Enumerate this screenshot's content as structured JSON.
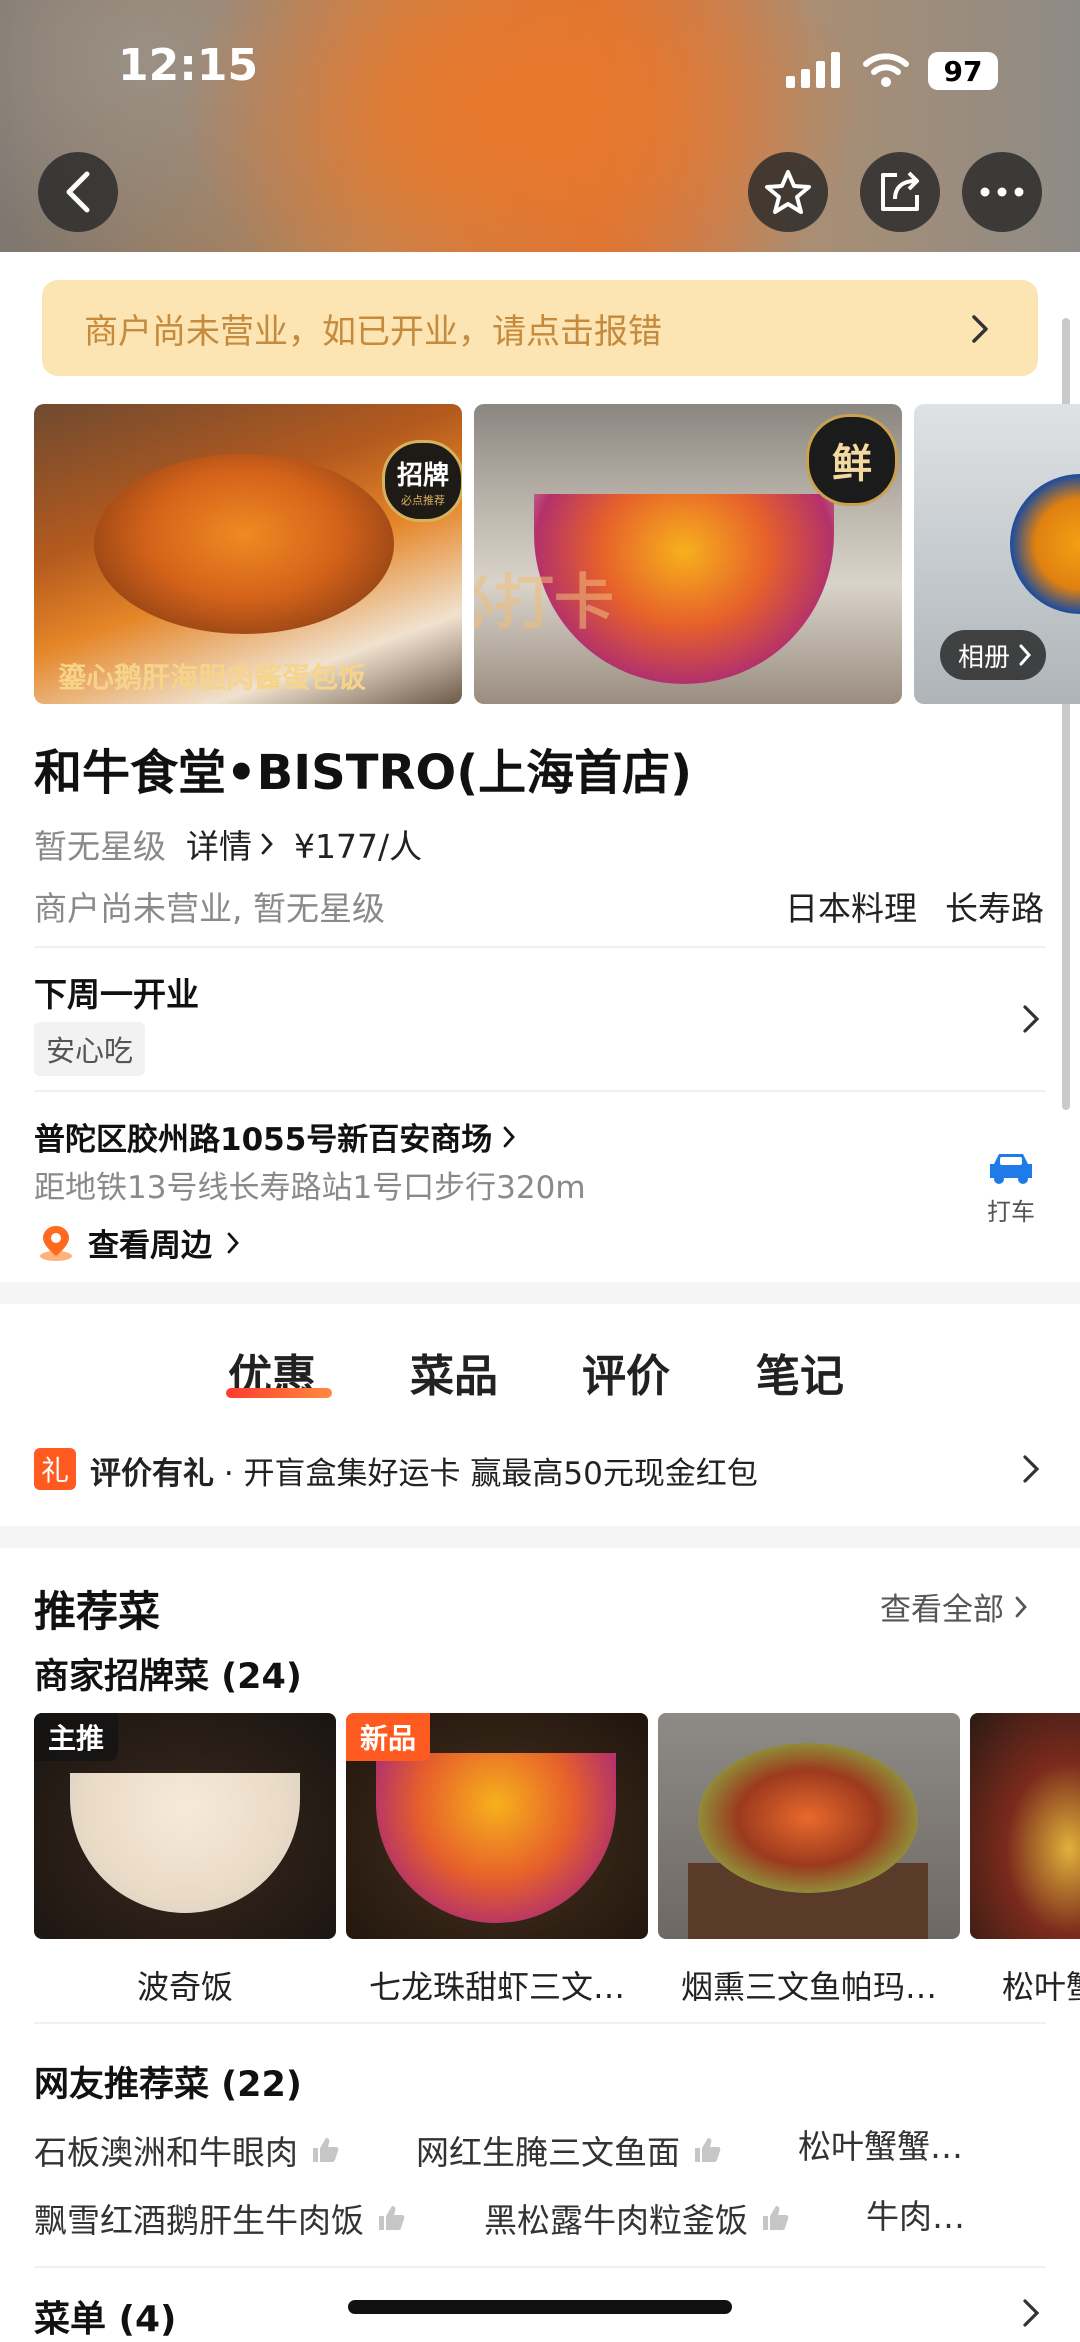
{
  "status": {
    "time": "12:15",
    "battery": "97"
  },
  "banner": {
    "text": "商户尚未营业，如已开业，请点击报错"
  },
  "gallery": {
    "photo1_caption": "鎏心鹅肝海胆肉酱蛋包饭",
    "photo1_badge": "招牌",
    "photo1_badge_sub": "必点推荐",
    "photo2_badge": "鲜",
    "photo2_overlay": "必打卡",
    "album_label": "相册"
  },
  "shop": {
    "name": "和牛食堂•BISTRO(上海首店)",
    "rating": "暂无星级",
    "detail_link": "详情",
    "price": "¥177/人",
    "status_note": "商户尚未营业, 暂无星级",
    "cuisine": "日本料理",
    "area": "长寿路"
  },
  "hours": {
    "text": "下周一开业",
    "tag": "安心吃"
  },
  "address": {
    "line": "普陀区胶州路1055号新百安商场",
    "distance": "距地铁13号线长寿路站1号口步行320m",
    "nearby": "查看周边",
    "taxi": "打车"
  },
  "tabs": [
    "优惠",
    "菜品",
    "评价",
    "笔记"
  ],
  "promo": {
    "icon": "礼",
    "bold": "评价有礼",
    "text": " · 开盲盒集好运卡 赢最高50元现金红包"
  },
  "recommend": {
    "title": "推荐菜",
    "view_all": "查看全部",
    "signature_title": "商家招牌菜 (24)",
    "dishes": [
      {
        "name": "波奇饭",
        "badge": "主推"
      },
      {
        "name": "七龙珠甜虾三文…",
        "badge": "新品"
      },
      {
        "name": "烟熏三文鱼帕玛…",
        "badge": ""
      },
      {
        "name": "松叶蟹",
        "badge": ""
      }
    ],
    "netizen_title": "网友推荐菜 (22)",
    "netizen_row1": [
      "石板澳洲和牛眼肉",
      "网红生腌三文鱼面",
      "松叶蟹蟹…"
    ],
    "netizen_row2": [
      "飘雪红酒鹅肝生牛肉饭",
      "黑松露牛肉粒釜饭",
      "牛肉…"
    ]
  },
  "menu": {
    "title": "菜单 (4)"
  },
  "colors": {
    "accent": "#ff5a1f",
    "banner_bg": "#fde4b3",
    "banner_text": "#c58a3c"
  }
}
